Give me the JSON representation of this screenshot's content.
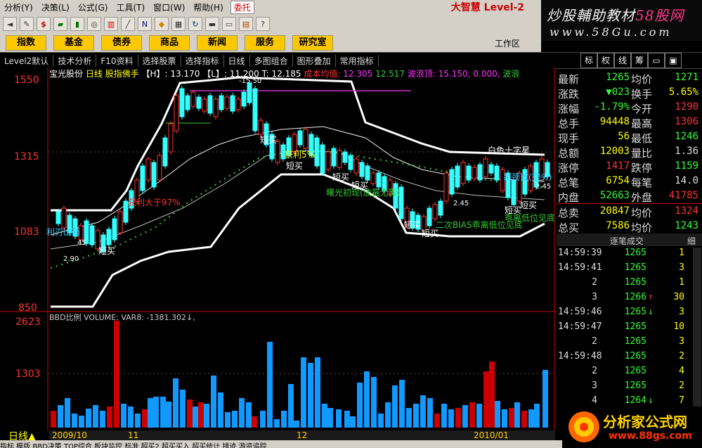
{
  "menu": {
    "items": [
      "分析(Y)",
      "决策(L)",
      "公式(G)",
      "工具(T)",
      "窗口(W)",
      "帮助(H)"
    ],
    "entrust": "委托",
    "brand": "大智慧 Level-2"
  },
  "watermark_top": {
    "title_a": "炒股輔助教材",
    "title_b": "58股网",
    "url": "www.58Gu.com"
  },
  "tabs": [
    "指数",
    "基金",
    "债券",
    "商品",
    "新闻",
    "服务",
    "研究室"
  ],
  "workarea": "工作区",
  "toolbar2": [
    "Level2默认",
    "技术分析",
    "F10资料",
    "选择股票",
    "选择指标",
    "日线",
    "多图组合",
    "图形叠加",
    "常用指标"
  ],
  "right_tabs": [
    "标",
    "权",
    "线",
    "筹"
  ],
  "chart_info": {
    "name": "宝光股份",
    "period": "日线",
    "indicator": "股指佛手",
    "h_label": "【H】:",
    "h_val": "13.170",
    "l_label": "【L】:",
    "l_val": "11.200",
    "t_label": "T:",
    "t_val": "12.185",
    "cost_label": "成本均值:",
    "cost_val": "12.305",
    "v2": "12.517",
    "wave_label": "波浪顶:",
    "wave_val": "15.150, 0.000,",
    "tail": "波浪"
  },
  "axis_price": [
    "1550",
    "1315",
    "1083",
    "850"
  ],
  "axis_volume": [
    "2623",
    "1303"
  ],
  "vol_info": "BBD比例 VOLUME: VAR8: -1381.302↓,",
  "annotations": [
    "短买",
    "短买",
    "短买",
    "短买",
    "短买",
    "短买",
    "短买",
    "短买",
    "短买",
    "获利5%",
    "获利大于97%",
    "利刃出鞘",
    "曙光初现(放量无影)",
    "二次BIAS乖离低位见底",
    "白色十字星",
    "吊颈首(空头)",
    "-15.50",
    "2.90",
    "2.45",
    "2.45",
    "45",
    "乖离低位见底"
  ],
  "quote": [
    {
      "l": "最新",
      "v": "1265",
      "vc": "#3f3",
      "l2": "均价",
      "v2": "1271",
      "v2c": "#3f3"
    },
    {
      "l": "涨跌",
      "v": "▼023",
      "vc": "#3f3",
      "l2": "换手",
      "v2": "5.65%",
      "v2c": "#ff0"
    },
    {
      "l": "涨幅",
      "v": "-1.79%",
      "vc": "#3f3",
      "l2": "今开",
      "v2": "1290",
      "v2c": "#f33"
    },
    {
      "l": "总手",
      "v": "94448",
      "vc": "#ff0",
      "l2": "最高",
      "v2": "1306",
      "v2c": "#f33"
    },
    {
      "l": "现手",
      "v": "56",
      "vc": "#ff0",
      "l2": "最低",
      "v2": "1246",
      "v2c": "#3f3"
    },
    {
      "l": "总额",
      "v": "12003",
      "vc": "#ff0",
      "l2": "量比",
      "v2": "1.36",
      "v2c": "#ddd"
    },
    {
      "l": "涨停",
      "v": "1417",
      "vc": "#f33",
      "l2": "跌停",
      "v2": "1159",
      "v2c": "#3f3"
    },
    {
      "l": "总笔",
      "v": "6754",
      "vc": "#ff0",
      "l2": "每笔",
      "v2": "14.0",
      "v2c": "#ddd"
    },
    {
      "l": "内盘",
      "v": "52663",
      "vc": "#3f3",
      "l2": "外盘",
      "v2": "41785",
      "v2c": "#f33"
    },
    {
      "l": "总卖",
      "v": "20847",
      "vc": "#ff0",
      "l2": "均价",
      "v2": "1324",
      "v2c": "#f33"
    },
    {
      "l": "总买",
      "v": "7586",
      "vc": "#ff0",
      "l2": "均价",
      "v2": "1243",
      "v2c": "#3f3"
    }
  ],
  "trades_head": {
    "title": "逐笔成交",
    "detail": "细"
  },
  "trades": [
    {
      "t": "14:59:39",
      "p": "1265",
      "a": "",
      "v": "1"
    },
    {
      "t": "14:59:41",
      "p": "1265",
      "a": "",
      "v": "3"
    },
    {
      "t": "2",
      "p": "1265",
      "a": "",
      "v": "1"
    },
    {
      "t": "3",
      "p": "1266",
      "a": "↑",
      "v": "30"
    },
    {
      "t": "14:59:46",
      "p": "1265",
      "a": "↓",
      "v": "3"
    },
    {
      "t": "14:59:47",
      "p": "1265",
      "a": "",
      "v": "10"
    },
    {
      "t": "2",
      "p": "1265",
      "a": "",
      "v": "3"
    },
    {
      "t": "14:59:48",
      "p": "1265",
      "a": "",
      "v": "2"
    },
    {
      "t": "2",
      "p": "1265",
      "a": "",
      "v": "4"
    },
    {
      "t": "3",
      "p": "1265",
      "a": "",
      "v": "2"
    },
    {
      "t": "4",
      "p": "1264",
      "a": "↓",
      "v": "7"
    }
  ],
  "watermark_bottom": {
    "name": "分析家公式网",
    "url": "www.88gs.com"
  },
  "dates": [
    "2009/10",
    "11",
    "12",
    "2010/01"
  ],
  "period_label": "日线",
  "bottom_tabs": "指标 模版 BBD决策 TOP综合 板块监控 标准 超买2 超买买入 超买统计 排迹 游资追踪"
}
